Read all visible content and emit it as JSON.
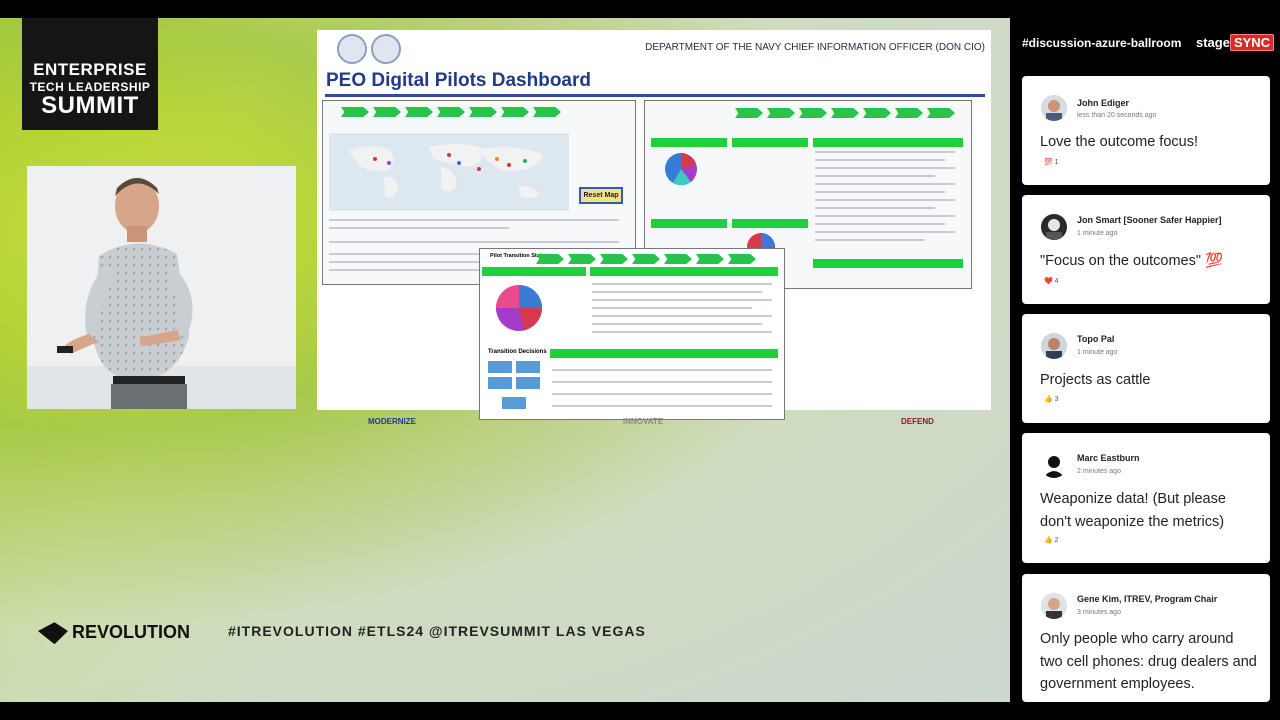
{
  "event": {
    "logo_line1": "ENTERPRISE",
    "logo_line2": "TECH LEADERSHIP",
    "logo_line3": "SUMMIT",
    "brand": "REVOLUTION",
    "hashtags": "#ITREVOLUTION  #ETLS24  @ITREVSUMMIT    LAS VEGAS"
  },
  "slide": {
    "department": "DEPARTMENT OF THE NAVY CHIEF INFORMATION OFFICER (DON CIO)",
    "title": "PEO Digital Pilots Dashboard",
    "reset_button": "Reset Map",
    "popup_title": "Pilot Transition Status",
    "transition_decisions": "Transition Decisions",
    "footer_left": "MODERNIZE",
    "footer_center": "INNOVATE",
    "footer_right": "DEFEND",
    "colors": {
      "title": "#1f3b8a",
      "green_banner": "#1ed13a",
      "defend": "#8a1a2a",
      "modernize": "#1f3b8a"
    }
  },
  "chat": {
    "channel": "#discussion-azure-ballroom",
    "brand_stage": "stage",
    "brand_sync": "SYNC",
    "messages": [
      {
        "name": "John Ediger",
        "time": "less than 20 seconds ago",
        "text": "Love the outcome focus!",
        "reaction": "💯 1"
      },
      {
        "name": "Jon Smart [Sooner Safer Happier]",
        "time": "1 minute ago",
        "text": "\"Focus on the outcomes\" 💯",
        "reaction": "❤️ 4"
      },
      {
        "name": "Topo Pal",
        "time": "1 minute ago",
        "text": "Projects as cattle",
        "reaction": "👍 3"
      },
      {
        "name": "Marc Eastburn",
        "time": "2 minutes ago",
        "text": "Weaponize data! (But please don't weaponize the metrics)",
        "reaction": "👍 2"
      },
      {
        "name": "Gene Kim, ITREV, Program Chair",
        "time": "3 minutes ago",
        "text": "Only people who carry around two cell phones: drug dealers and government employees.",
        "reaction": ""
      }
    ]
  }
}
